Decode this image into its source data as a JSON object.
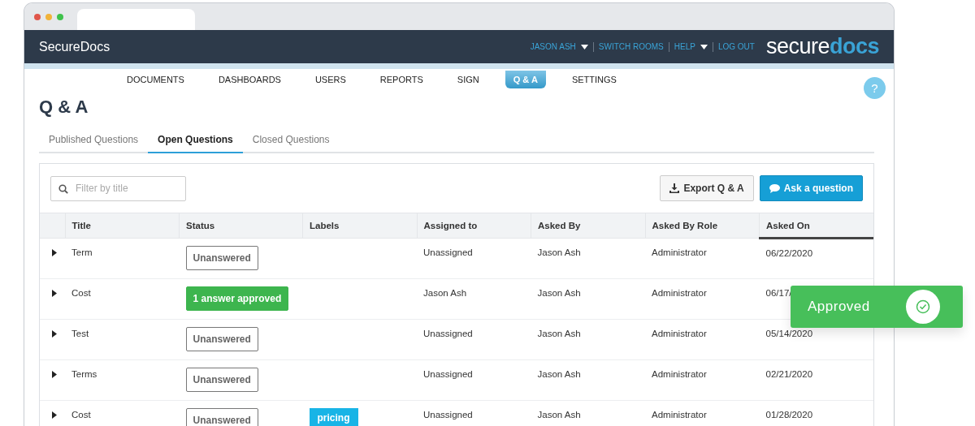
{
  "app": {
    "name": "SecureDocs",
    "logo": "secure**docs**"
  },
  "user_menu": [
    {
      "label": "JASON ASH",
      "dropdown": true
    },
    {
      "label": "SWITCH ROOMS",
      "dropdown": false
    },
    {
      "label": "HELP",
      "dropdown": true
    },
    {
      "label": "LOG OUT",
      "dropdown": false
    }
  ],
  "nav": [
    {
      "label": "DOCUMENTS",
      "selected": false
    },
    {
      "label": "DASHBOARDS",
      "selected": false
    },
    {
      "label": "USERS",
      "selected": false
    },
    {
      "label": "REPORTS",
      "selected": false
    },
    {
      "label": "SIGN",
      "selected": false
    },
    {
      "label": "Q & A",
      "selected": true
    },
    {
      "label": "SETTINGS",
      "selected": false
    }
  ],
  "help_button": "?",
  "page_title": "Q & A",
  "tabs": [
    {
      "label": "Published Questions",
      "selected": false
    },
    {
      "label": "Open Questions",
      "selected": true
    },
    {
      "label": "Closed Questions",
      "selected": false
    }
  ],
  "filter": {
    "placeholder": "Filter by title"
  },
  "buttons": [
    {
      "label": "Export Q & A",
      "kind": "export"
    },
    {
      "label": "Ask a question",
      "kind": "ask"
    }
  ],
  "table": {
    "columns": [
      {
        "label": "Title",
        "sorted": false
      },
      {
        "label": "Status",
        "sorted": false
      },
      {
        "label": "Labels",
        "sorted": false
      },
      {
        "label": "Assigned to",
        "sorted": false
      },
      {
        "label": "Asked By",
        "sorted": false
      },
      {
        "label": "Asked By Role",
        "sorted": false
      },
      {
        "label": "Asked On",
        "sorted": true
      }
    ],
    "rows": [
      {
        "title": "Term",
        "status": "Unanswered",
        "kind": "unanswered",
        "labels": [],
        "assigned_to": "Unassigned",
        "asked_by": "Jason Ash",
        "role": "Administrator",
        "asked_on": "06/22/2020"
      },
      {
        "title": "Cost",
        "status": "1 answer approved",
        "kind": "approved",
        "labels": [],
        "assigned_to": "Jason Ash",
        "asked_by": "Jason Ash",
        "role": "Administrator",
        "asked_on": "06/17/"
      },
      {
        "title": "Test",
        "status": "Unanswered",
        "kind": "unanswered",
        "labels": [],
        "assigned_to": "Unassigned",
        "asked_by": "Jason Ash",
        "role": "Administrator",
        "asked_on": "05/14/2020"
      },
      {
        "title": "Terms",
        "status": "Unanswered",
        "kind": "unanswered",
        "labels": [],
        "assigned_to": "Unassigned",
        "asked_by": "Jason Ash",
        "role": "Administrator",
        "asked_on": "02/21/2020"
      },
      {
        "title": "Cost",
        "status": "Unanswered",
        "kind": "unanswered",
        "labels": [
          "pricing"
        ],
        "assigned_to": "Unassigned",
        "asked_by": "Jason Ash",
        "role": "Administrator",
        "asked_on": "01/28/2020"
      }
    ]
  },
  "toast": {
    "text": "Approved"
  }
}
